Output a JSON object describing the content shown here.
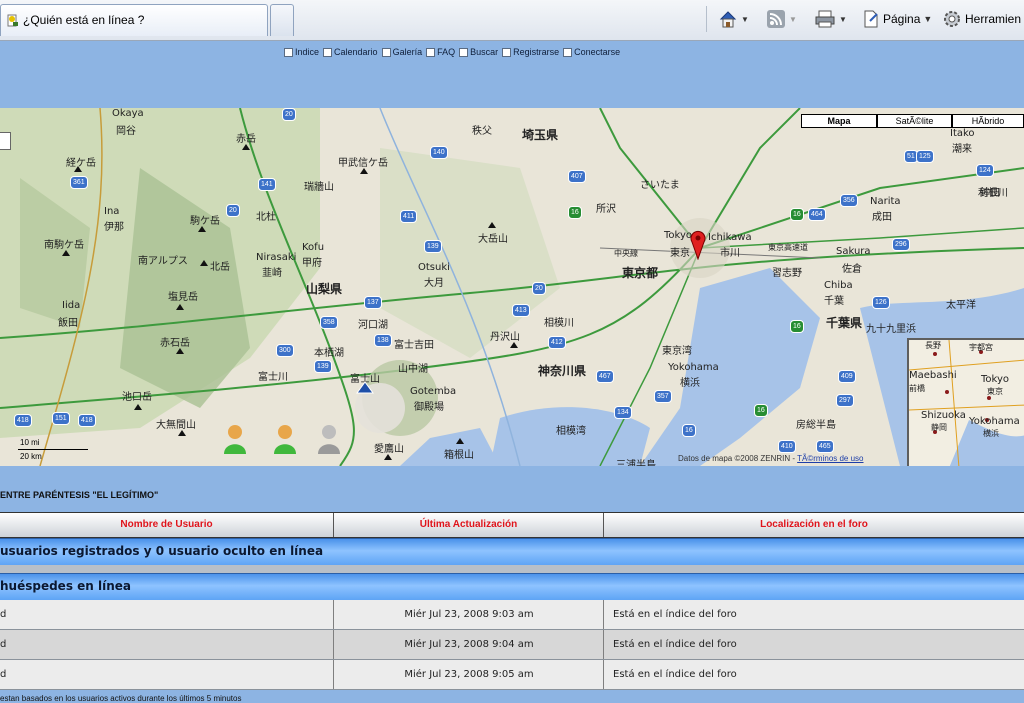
{
  "browser": {
    "tab_title": "¿Quién está en línea ?",
    "toolbar": {
      "pagina_label": "Página",
      "herramientas_label": "Herramien"
    }
  },
  "forum_nav": [
    {
      "label": "Indice",
      "icon": "index-icon"
    },
    {
      "label": "Calendario",
      "icon": "calendar-icon"
    },
    {
      "label": "Galería",
      "icon": "gallery-icon"
    },
    {
      "label": "FAQ",
      "icon": "faq-icon"
    },
    {
      "label": "Buscar",
      "icon": "search-icon"
    },
    {
      "label": "Registrarse",
      "icon": "register-icon"
    },
    {
      "label": "Conectarse",
      "icon": "login-icon"
    }
  ],
  "map": {
    "type_buttons": {
      "map": "Mapa",
      "satellite": "SatÃ©lite",
      "hybrid": "HÃ­brido"
    },
    "scale": {
      "mi": "10 mi",
      "km": "20 km"
    },
    "copyright": "Datos de mapa ©2008 ZENRIN - ",
    "copyright_link": "TÃ©rminos de uso",
    "labels": [
      "Okaya",
      "岡谷",
      "赤岳",
      "秩父",
      "埼玉県",
      "Itako",
      "潮来",
      "経ケ岳",
      "甲武信ケ岳",
      "瑞牆山",
      "さいたま",
      "所沢",
      "鉾田",
      "Narita",
      "成田",
      "Ina",
      "伊那",
      "駒ケ岳",
      "北杜",
      "大岳山",
      "Tokyo",
      "Ichikawa",
      "市川",
      "東京",
      "東京都",
      "中央線",
      "東京高速道",
      "南駒ケ岳",
      "南アルプス",
      "北岳",
      "Nirasaki",
      "韮崎",
      "Kofu",
      "甲府",
      "Otsuki",
      "大月",
      "Sakura",
      "佐倉",
      "習志野",
      "利根川",
      "山梨県",
      "塩見岳",
      "Iida",
      "飯田",
      "河口湖",
      "相模川",
      "Chiba",
      "千葉",
      "太平洋",
      "千葉県",
      "九十九里浜",
      "赤石岳",
      "本栖湖",
      "富士吉田",
      "丹沢山",
      "東京湾",
      "富士川",
      "山中湖",
      "神奈川県",
      "Yokohama",
      "横浜",
      "富士山",
      "池口岳",
      "Gotemba",
      "御殿場",
      "大無間山",
      "房総半島",
      "相模湾",
      "愛鷹山",
      "箱根山",
      "三浦半島"
    ],
    "overview_labels": [
      "長野",
      "宇都宮",
      "Maebashi",
      "前橋",
      "Tokyo",
      "東京",
      "Shizuoka",
      "静岡",
      "Yokohama",
      "横浜"
    ],
    "route_shields": [
      "20",
      "140",
      "361",
      "141",
      "20",
      "411",
      "139",
      "20",
      "413",
      "137",
      "358",
      "300",
      "139",
      "138",
      "412",
      "467",
      "357",
      "134",
      "16",
      "126",
      "356",
      "464",
      "16",
      "296",
      "297",
      "409",
      "410",
      "465",
      "418",
      "151",
      "418",
      "407",
      "16",
      "16",
      "16",
      "124",
      "51",
      "125"
    ]
  },
  "forum": {
    "section_title": "ENTRE PARÉNTESIS \"EL LEGÍTIMO\"",
    "columns": [
      "Nombre de Usuario",
      "Última Actualización",
      "Localización en el foro"
    ],
    "group_registered": "usuarios registrados y 0 usuario oculto en línea",
    "group_guests": "huéspedes en línea",
    "rows": [
      {
        "name": "d",
        "updated": "Miér Jul 23, 2008 9:03 am",
        "location": "Está en el índice del foro"
      },
      {
        "name": "d",
        "updated": "Miér Jul 23, 2008 9:04 am",
        "location": "Está en el índice del foro"
      },
      {
        "name": "d",
        "updated": "Miér Jul 23, 2008 9:05 am",
        "location": "Está en el índice del foro"
      }
    ],
    "footer_note": "estan basados en los usuarios activos durante los últimos 5 minutos"
  },
  "colors": {
    "page_bg": "#8db4e3",
    "header_text": "#e0141b",
    "group_bar": "#5ea4f5"
  }
}
